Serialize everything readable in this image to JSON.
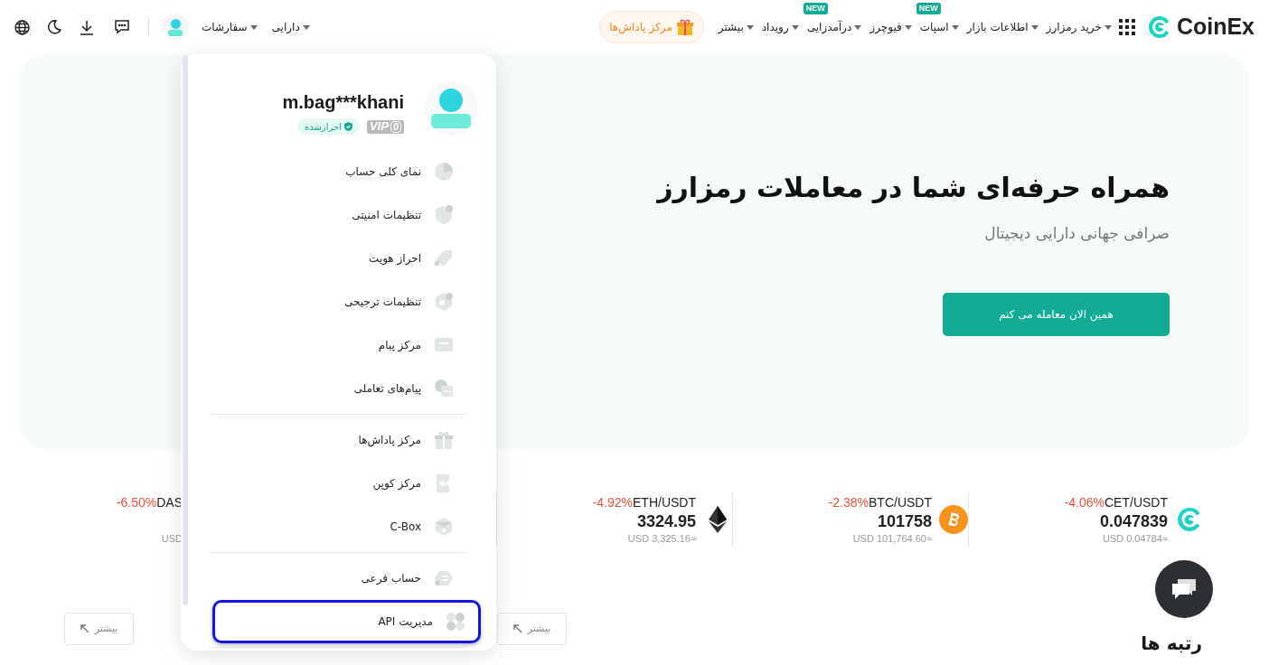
{
  "nav": {
    "logo": "CoinEx",
    "menu": [
      {
        "label": "خرید رمزارز"
      },
      {
        "label": "اطلاعات بازار"
      },
      {
        "label": "اسپات",
        "badge": "NEW"
      },
      {
        "label": "فیوچرز"
      },
      {
        "label": "درآمدزایی",
        "badge": "NEW"
      },
      {
        "label": "رویداد"
      },
      {
        "label": "بیشتر"
      }
    ],
    "reward": "مرکز پاداش‌ها",
    "user_menu": [
      "دارایی",
      "سفارشات"
    ]
  },
  "hero": {
    "title": "همراه حرفه‌ای شما در معاملات رمزارز",
    "subtitle": "صرافی جهانی دارایی دیجیتال",
    "button": "همین الان معامله می کنم"
  },
  "tickers": [
    {
      "kind": "full",
      "pair": "CET/USDT",
      "change": "-4.06%",
      "price": "0.047839",
      "usd": "USD 0.04784≈"
    },
    {
      "kind": "full",
      "pair": "BTC/USDT",
      "change": "-2.38%",
      "price": "101758",
      "usd": "USD 101,764.60≈"
    },
    {
      "kind": "full",
      "pair": "ETH/USDT",
      "change": "-4.92%",
      "price": "3324.95",
      "usd": "USD 3,325.16≈"
    },
    {
      "kind": "clipped",
      "pair": "DAS",
      "change": "-6.50%",
      "usd": "USD"
    }
  ],
  "more_buttons": [
    "بیشتر",
    "بیشتر"
  ],
  "section_heading": "رتبه ها",
  "account_menu": {
    "username": "m.bag***khani",
    "vip": "VIP",
    "vip_level": "0",
    "verified": "احرازشده",
    "groups": [
      [
        {
          "label": "نمای کلی حساب",
          "selected": false
        },
        {
          "label": "تنظیمات امنیتی",
          "selected": false
        },
        {
          "label": "احراز هویت",
          "selected": false
        },
        {
          "label": "تنظیمات ترجیحی",
          "selected": false
        },
        {
          "label": "مرکز پیام",
          "selected": false
        },
        {
          "label": "پیام‌های تعاملی",
          "selected": false
        }
      ],
      [
        {
          "label": "مرکز پاداش‌ها",
          "selected": false
        },
        {
          "label": "مرکز کوپن",
          "selected": false
        },
        {
          "label": "C-Box",
          "selected": false
        }
      ],
      [
        {
          "label": "حساب فرعی",
          "selected": false
        },
        {
          "label": "مدیریت API",
          "selected": true
        }
      ]
    ]
  }
}
